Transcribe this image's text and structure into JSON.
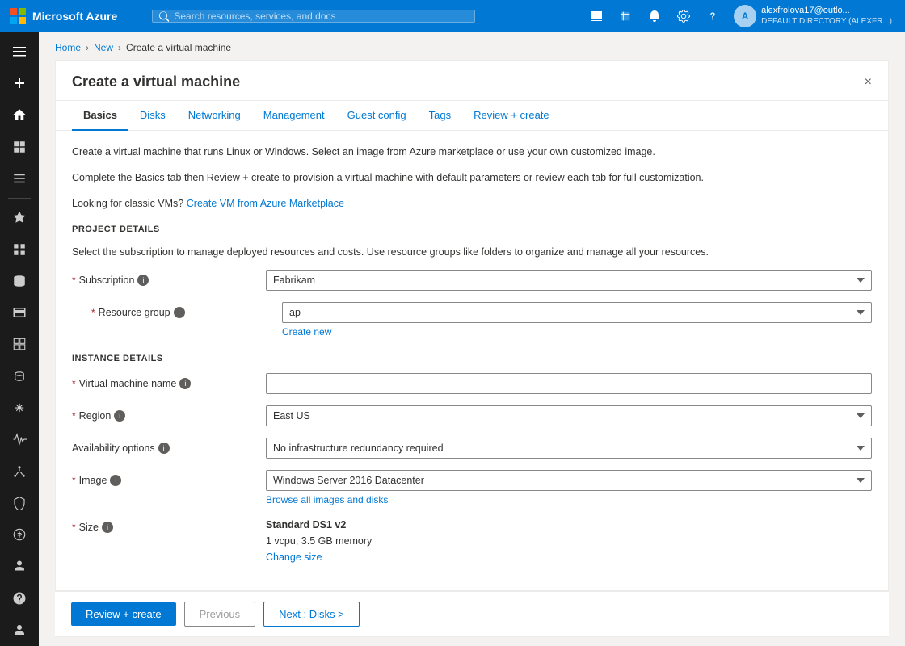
{
  "topbar": {
    "brand": "Microsoft Azure",
    "search_placeholder": "Search resources, services, and docs",
    "user_name": "alexfrolova17@outlo...",
    "user_dir": "DEFAULT DIRECTORY (ALEXFR...)",
    "user_initials": "A"
  },
  "breadcrumb": {
    "home": "Home",
    "new": "New",
    "current": "Create a virtual machine"
  },
  "panel": {
    "title": "Create a virtual machine",
    "close_label": "×"
  },
  "tabs": [
    {
      "id": "basics",
      "label": "Basics",
      "active": true
    },
    {
      "id": "disks",
      "label": "Disks",
      "active": false
    },
    {
      "id": "networking",
      "label": "Networking",
      "active": false
    },
    {
      "id": "management",
      "label": "Management",
      "active": false
    },
    {
      "id": "guest_config",
      "label": "Guest config",
      "active": false
    },
    {
      "id": "tags",
      "label": "Tags",
      "active": false
    },
    {
      "id": "review_create",
      "label": "Review + create",
      "active": false
    }
  ],
  "intro": {
    "line1": "Create a virtual machine that runs Linux or Windows. Select an image from Azure marketplace or use your own customized image.",
    "line2": "Complete the Basics tab then Review + create to provision a virtual machine with default parameters or review each tab for full customization.",
    "classic_text": "Looking for classic VMs?",
    "classic_link": "Create VM from Azure Marketplace"
  },
  "project_details": {
    "header": "PROJECT DETAILS",
    "description": "Select the subscription to manage deployed resources and costs. Use resource groups like folders to organize and manage all your resources.",
    "subscription_label": "Subscription",
    "subscription_value": "Fabrikam",
    "resource_group_label": "Resource group",
    "resource_group_value": "ap",
    "create_new_label": "Create new"
  },
  "instance_details": {
    "header": "INSTANCE DETAILS",
    "vm_name_label": "Virtual machine name",
    "vm_name_value": "",
    "region_label": "Region",
    "region_value": "East US",
    "availability_label": "Availability options",
    "availability_value": "No infrastructure redundancy required",
    "image_label": "Image",
    "image_value": "Windows Server 2016 Datacenter",
    "browse_images_label": "Browse all images and disks",
    "size_label": "Size",
    "size_name": "Standard DS1 v2",
    "size_detail": "1 vcpu, 3.5 GB memory",
    "size_change_label": "Change size"
  },
  "footer": {
    "review_create_label": "Review + create",
    "previous_label": "Previous",
    "next_label": "Next : Disks >"
  },
  "sidebar": {
    "items": [
      {
        "id": "home",
        "icon": "home"
      },
      {
        "id": "dashboard",
        "icon": "dashboard"
      },
      {
        "id": "all-services",
        "icon": "list"
      },
      {
        "id": "favorites-header",
        "icon": "star"
      },
      {
        "id": "portal",
        "icon": "apps"
      },
      {
        "id": "storage",
        "icon": "storage"
      },
      {
        "id": "subscriptions",
        "icon": "subscriptions"
      },
      {
        "id": "resource-groups",
        "icon": "resource-groups"
      },
      {
        "id": "sql",
        "icon": "sql"
      },
      {
        "id": "kubernetes",
        "icon": "kubernetes"
      },
      {
        "id": "monitor",
        "icon": "monitor"
      },
      {
        "id": "load-balancer",
        "icon": "load-balancer"
      },
      {
        "id": "security",
        "icon": "security"
      },
      {
        "id": "cost-management",
        "icon": "cost"
      },
      {
        "id": "azure-ad",
        "icon": "azure-ad"
      },
      {
        "id": "help",
        "icon": "help"
      },
      {
        "id": "user-settings",
        "icon": "user-settings"
      }
    ]
  }
}
